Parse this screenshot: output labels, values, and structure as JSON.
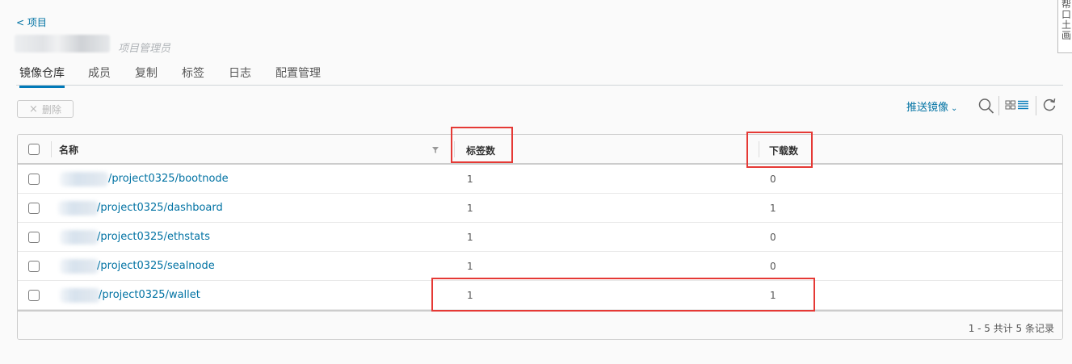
{
  "breadcrumb": {
    "back_label": "< 项目"
  },
  "header": {
    "role_label": "项目管理员"
  },
  "tabs": [
    {
      "label": "镜像仓库",
      "active": true
    },
    {
      "label": "成员",
      "active": false
    },
    {
      "label": "复制",
      "active": false
    },
    {
      "label": "标签",
      "active": false
    },
    {
      "label": "日志",
      "active": false
    },
    {
      "label": "配置管理",
      "active": false
    }
  ],
  "toolbar": {
    "delete_icon": "×",
    "delete_label": "删除",
    "push_label": "推送镜像",
    "push_chevron": "⌄",
    "icons": [
      "search-icon",
      "grid-view-icon",
      "list-view-icon",
      "refresh-icon"
    ]
  },
  "side_widget": {
    "text": "帮 口 土 画"
  },
  "table": {
    "columns": [
      "名称",
      "标签数",
      "下载数"
    ],
    "rows": [
      {
        "name": "/project0325/bootnode",
        "tags": "1",
        "pulls": "0"
      },
      {
        "name": "/project0325/dashboard",
        "tags": "1",
        "pulls": "1"
      },
      {
        "name": "/project0325/ethstats",
        "tags": "1",
        "pulls": "0"
      },
      {
        "name": "/project0325/sealnode",
        "tags": "1",
        "pulls": "0"
      },
      {
        "name": "/project0325/wallet",
        "tags": "1",
        "pulls": "1"
      }
    ],
    "footer": "1 - 5 共计 5 条记录"
  },
  "colors": {
    "link": "#0072a3",
    "active_tab": "#0079b8",
    "highlight": "#e53935"
  }
}
